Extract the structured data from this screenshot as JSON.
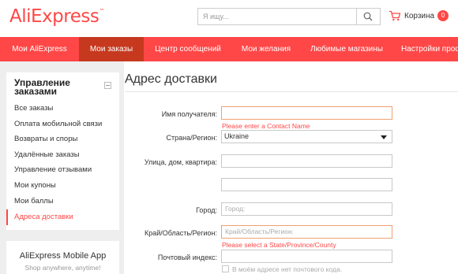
{
  "header": {
    "logo": "AliExpress",
    "logo_tm": "™",
    "search_placeholder": "Я ищу...",
    "cart_label": "Корзина",
    "cart_count": "0"
  },
  "nav": {
    "tabs": [
      {
        "label": "Мои AliExpress"
      },
      {
        "label": "Мои заказы"
      },
      {
        "label": "Центр сообщений"
      },
      {
        "label": "Мои желания"
      },
      {
        "label": "Любимые магазины"
      },
      {
        "label": "Настройки проф"
      }
    ],
    "active_index": 1
  },
  "sidebar": {
    "title": "Управление заказами",
    "items": [
      {
        "label": "Все заказы"
      },
      {
        "label": "Оплата мобильной связи"
      },
      {
        "label": "Возвраты и споры"
      },
      {
        "label": "Удалённые заказы"
      },
      {
        "label": "Управление отзывами"
      },
      {
        "label": "Мои купоны"
      },
      {
        "label": "Мои баллы"
      },
      {
        "label": "Адреса доставки"
      }
    ],
    "active_index": 7
  },
  "promo": {
    "title": "AliExpress Mobile App",
    "subtitle": "Shop anywhere, anytime!"
  },
  "form": {
    "title": "Адрес доставки",
    "contact_label": "Имя получателя:",
    "contact_value": "",
    "contact_error": "Please enter a Contact Name",
    "country_label": "Страна/Регион:",
    "country_value": "Ukraine",
    "street_label": "Улица, дом, квартира:",
    "street_value": "",
    "street2_value": "",
    "city_label": "Город:",
    "city_placeholder": "Город:",
    "region_label": "Край/Область/Регион:",
    "region_placeholder": "Край/Область/Регион:",
    "region_error": "Please select a State/Province/County",
    "zip_label": "Почтовый индекс:",
    "zip_value": "",
    "nozip_label": "В моём адресе нет почтового кода."
  },
  "colors": {
    "brand": "#ff4747",
    "nav_active": "#c6391f",
    "page_bg": "#eeeeee"
  }
}
